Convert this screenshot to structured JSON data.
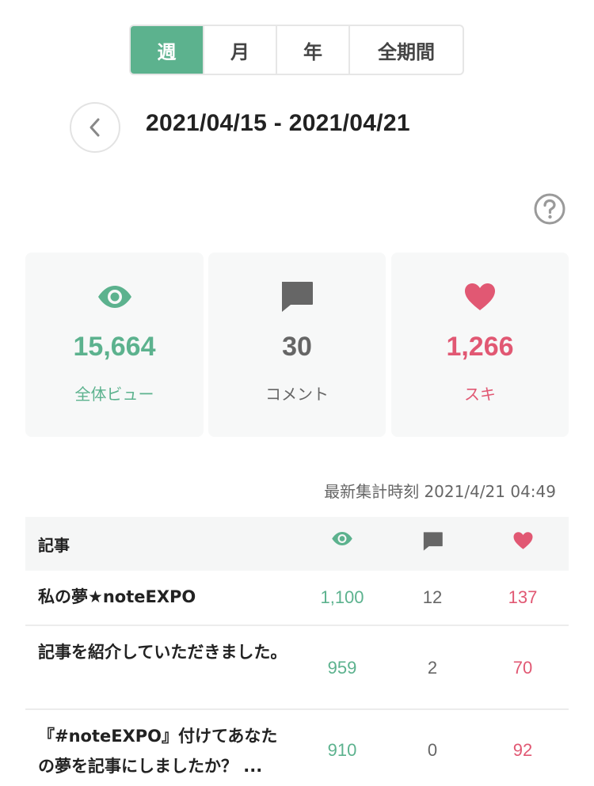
{
  "period_tabs": [
    {
      "label": "週",
      "active": true
    },
    {
      "label": "月",
      "active": false
    },
    {
      "label": "年",
      "active": false
    },
    {
      "label": "全期間",
      "active": false
    }
  ],
  "date_range": "2021/04/15 - 2021/04/21",
  "summary": {
    "views": {
      "value": "15,664",
      "label": "全体ビュー",
      "icon": "eye-icon",
      "color": "#5cb28e"
    },
    "comments": {
      "value": "30",
      "label": "コメント",
      "icon": "comment-icon",
      "color": "#666666"
    },
    "likes": {
      "value": "1,266",
      "label": "スキ",
      "icon": "heart-icon",
      "color": "#e15873"
    }
  },
  "updated_at": "最新集計時刻 2021/4/21 04:49",
  "table": {
    "header_title": "記事",
    "rows": [
      {
        "title": "私の夢★noteEXPO",
        "views": "1,100",
        "comments": "12",
        "likes": "137"
      },
      {
        "title": "記事を紹介していただきました。",
        "views": "959",
        "comments": "2",
        "likes": "70"
      },
      {
        "title": "『#noteEXPO』付けてあなたの夢を記事にしましたか？ ...",
        "views": "910",
        "comments": "0",
        "likes": "92"
      }
    ]
  }
}
